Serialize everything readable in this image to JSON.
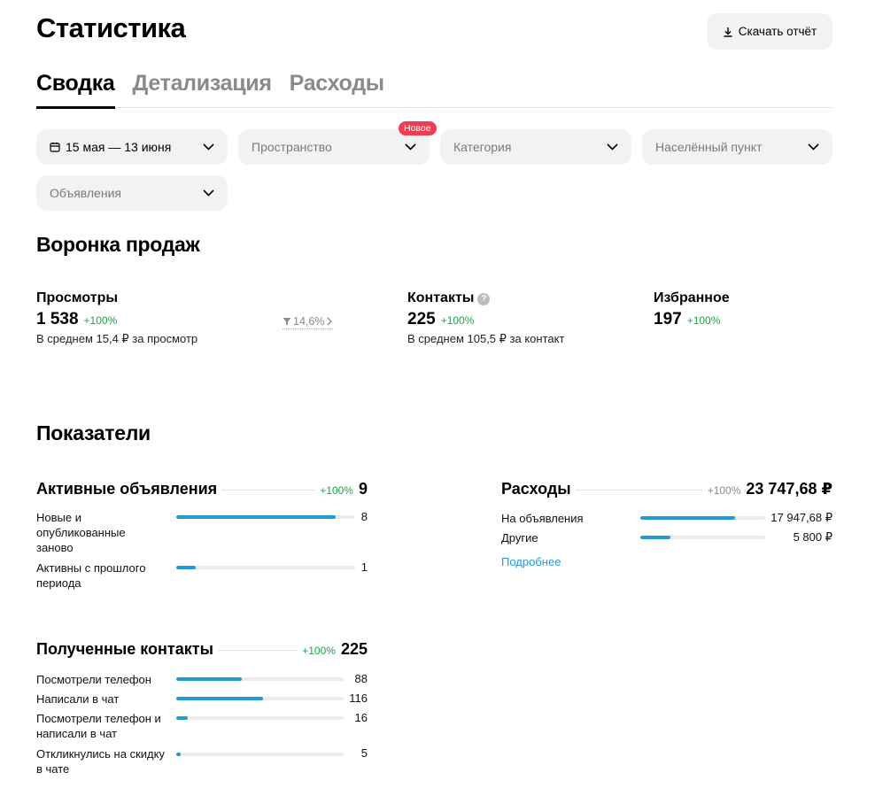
{
  "page_title": "Статистика",
  "download_label": "Скачать отчёт",
  "tabs": [
    {
      "label": "Сводка",
      "active": true
    },
    {
      "label": "Детализация",
      "active": false
    },
    {
      "label": "Расходы",
      "active": false
    }
  ],
  "filters": {
    "period": "15 мая — 13 июня",
    "space": "Пространство",
    "space_badge": "Новое",
    "category": "Категория",
    "locality": "Населённый пункт",
    "ads": "Объявления"
  },
  "funnel": {
    "title": "Воронка продаж",
    "views": {
      "label": "Просмотры",
      "value": "1 538",
      "pct": "+100%",
      "note": "В среднем 15,4 ₽ за просмотр"
    },
    "conversion": "14,6%",
    "contacts": {
      "label": "Контакты",
      "value": "225",
      "pct": "+100%",
      "note": "В среднем 105,5 ₽ за контакт"
    },
    "favorites": {
      "label": "Избранное",
      "value": "197",
      "pct": "+100%"
    }
  },
  "indicators": {
    "title": "Показатели",
    "active_ads": {
      "title": "Активные объявления",
      "pct": "+100%",
      "total": "9",
      "rows": [
        {
          "label": "Новые и опубликованные заново",
          "value": "8",
          "fill": 0.89
        },
        {
          "label": "Активны с прошлого периода",
          "value": "1",
          "fill": 0.11
        }
      ]
    },
    "expenses": {
      "title": "Расходы",
      "pct": "+100%",
      "total": "23 747,68 ₽",
      "rows": [
        {
          "label": "На объявления",
          "value": "17 947,68 ₽",
          "fill": 0.76
        },
        {
          "label": "Другие",
          "value": "5 800 ₽",
          "fill": 0.24
        }
      ],
      "more": "Подробнее"
    },
    "contacts": {
      "title": "Полученные контакты",
      "pct": "+100%",
      "total": "225",
      "rows": [
        {
          "label": "Посмотрели телефон",
          "value": "88",
          "fill": 0.39
        },
        {
          "label": "Написали в чат",
          "value": "116",
          "fill": 0.52
        },
        {
          "label": "Посмотрели телефон и написали в чат",
          "value": "16",
          "fill": 0.07
        },
        {
          "label": "Откликнулись на скидку в чате",
          "value": "5",
          "fill": 0.025
        }
      ]
    }
  }
}
